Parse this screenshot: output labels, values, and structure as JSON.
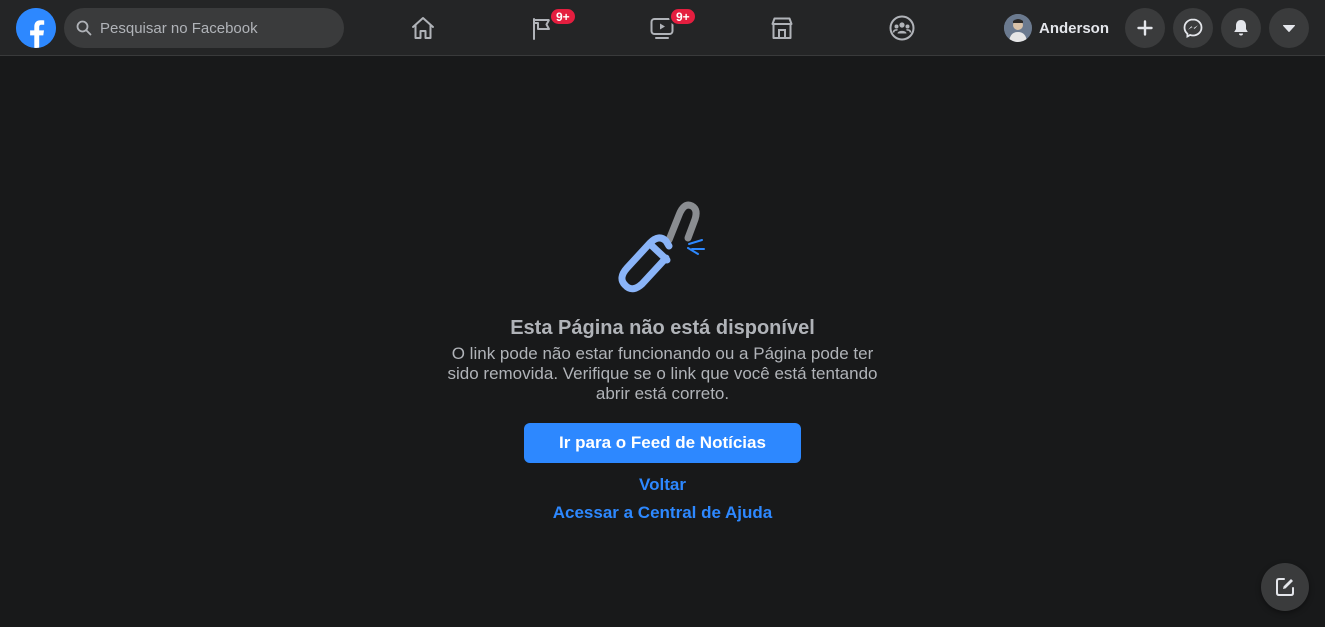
{
  "header": {
    "search": {
      "placeholder": "Pesquisar no Facebook"
    },
    "nav": {
      "home_icon": "home-icon",
      "pages_icon": "flag-icon",
      "pages_badge": "9+",
      "watch_icon": "video-icon",
      "watch_badge": "9+",
      "marketplace_icon": "store-icon",
      "groups_icon": "groups-icon"
    },
    "profile": {
      "name": "Anderson"
    },
    "actions": [
      "plus-icon",
      "messenger-icon",
      "bell-icon",
      "caret-down-icon"
    ]
  },
  "main": {
    "title": "Esta Página não está disponível",
    "description": "O link pode não estar funcionando ou a Página pode ter sido removida. Verifique se o link que você está tentando abrir está correto.",
    "primary_button": "Ir para o Feed de Notícias",
    "back_link": "Voltar",
    "help_link": "Acessar a Central de Ajuda"
  },
  "colors": {
    "accent": "#2d88ff",
    "background": "#18191a",
    "topbar": "#242526",
    "badge": "#e41e3f"
  }
}
